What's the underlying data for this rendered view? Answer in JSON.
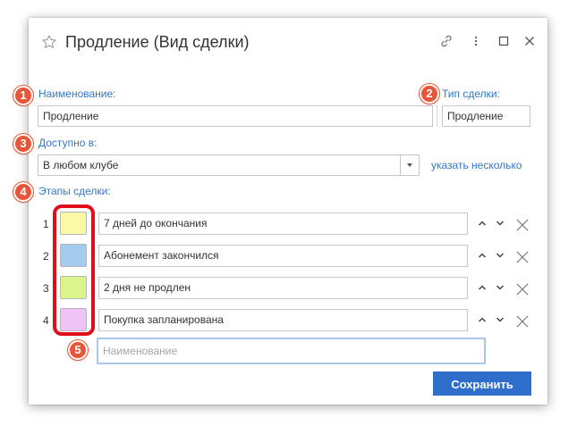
{
  "window": {
    "title": "Продление (Вид сделки)"
  },
  "form": {
    "name_label": "Наименование:",
    "name_value": "Продление",
    "type_label": "Тип сделки:",
    "type_value": "Продление",
    "available_label": "Доступно в:",
    "available_value": "В любом клубе",
    "specify_several_link": "указать несколько",
    "stages_label": "Этапы сделки:",
    "stages": [
      {
        "number": "1",
        "color": "#fbf8a6",
        "name": "7 дней до окончания"
      },
      {
        "number": "2",
        "color": "#a5cbf0",
        "name": "Абонемент закончился"
      },
      {
        "number": "3",
        "color": "#dbf58c",
        "name": "2 дня не продлен"
      },
      {
        "number": "4",
        "color": "#eec4f5",
        "name": "Покупка запланирована"
      }
    ],
    "new_stage_placeholder": "Наименование",
    "save_label": "Сохранить"
  },
  "annotations": [
    "1",
    "2",
    "3",
    "4",
    "5"
  ],
  "colors": {
    "accent": "#3577c1",
    "save_button": "#2f6fcb",
    "annotation": "#e8563a",
    "highlight_box": "#e00d1a"
  }
}
